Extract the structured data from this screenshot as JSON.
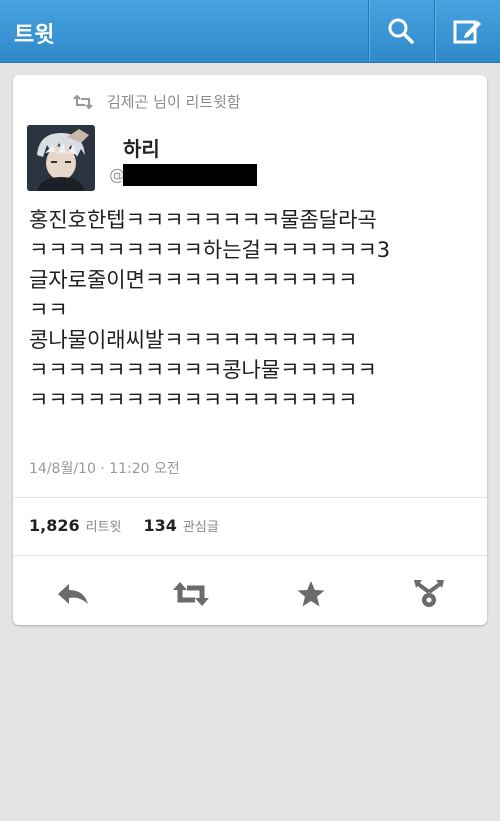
{
  "header": {
    "title": "트윗",
    "search_icon": "search-icon",
    "compose_icon": "compose-icon",
    "bar_color": "#3b96d6"
  },
  "tweet": {
    "retweeted_by": "김제곤 님이 리트윗함",
    "display_name": "하리",
    "handle_prefix": "@",
    "text_lines": [
      "홍진호한텝ㅋㅋㅋㅋㅋㅋㅋㅋ물좀달라곡",
      "ㅋㅋㅋㅋㅋㅋㅋㅋㅋ하는걸ㅋㅋㅋㅋㅋㅋ3",
      "글자로줄이면ㅋㅋㅋㅋㅋㅋㅋㅋㅋㅋㅋ",
      "ㅋㅋ",
      "콩나물이래씨발ㅋㅋㅋㅋㅋㅋㅋㅋㅋㅋ",
      "ㅋㅋㅋㅋㅋㅋㅋㅋㅋㅋ콩나물ㅋㅋㅋㅋㅋ",
      "ㅋㅋㅋㅋㅋㅋㅋㅋㅋㅋㅋㅋㅋㅋㅋㅋㅋ"
    ],
    "timestamp": "14/8월/10 · 11:20 오전",
    "retweet_count": "1,826",
    "retweet_label": "리트윗",
    "favorite_count": "134",
    "favorite_label": "관심글"
  },
  "actions": [
    "reply-icon",
    "retweet-icon",
    "favorite-star-icon",
    "share-icon"
  ]
}
